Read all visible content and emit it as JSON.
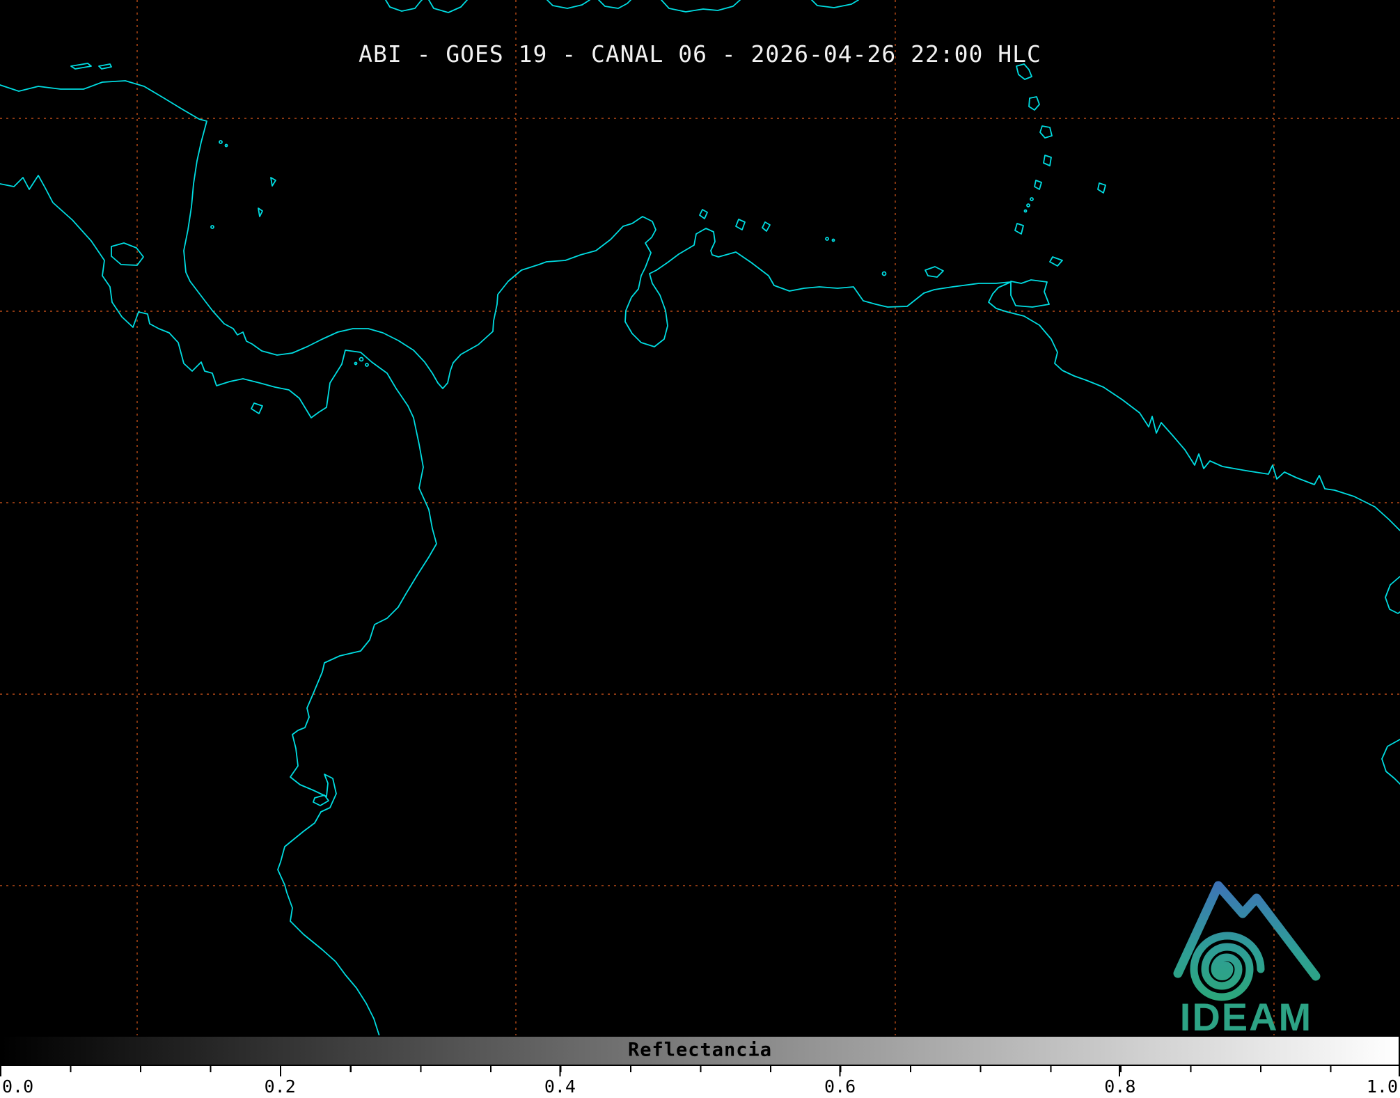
{
  "header": {
    "title": "ABI - GOES 19 - CANAL 06 - 2026-04-26 22:00 HLC"
  },
  "map": {
    "background_color": "#000000",
    "coastline_color": "#00dde2",
    "graticule_color": "#c3511a"
  },
  "colorbar": {
    "label": "Reflectancia",
    "min": "0.0",
    "max": "1.0",
    "ticks": [
      "0.0",
      "0.2",
      "0.4",
      "0.6",
      "0.8",
      "1.0"
    ],
    "gradient_start": "#000000",
    "gradient_end": "#ffffff"
  },
  "logo": {
    "text": "IDEAM",
    "color_top": "#3e72b8",
    "color_bottom": "#2ca877",
    "text_color": "#2da385"
  }
}
